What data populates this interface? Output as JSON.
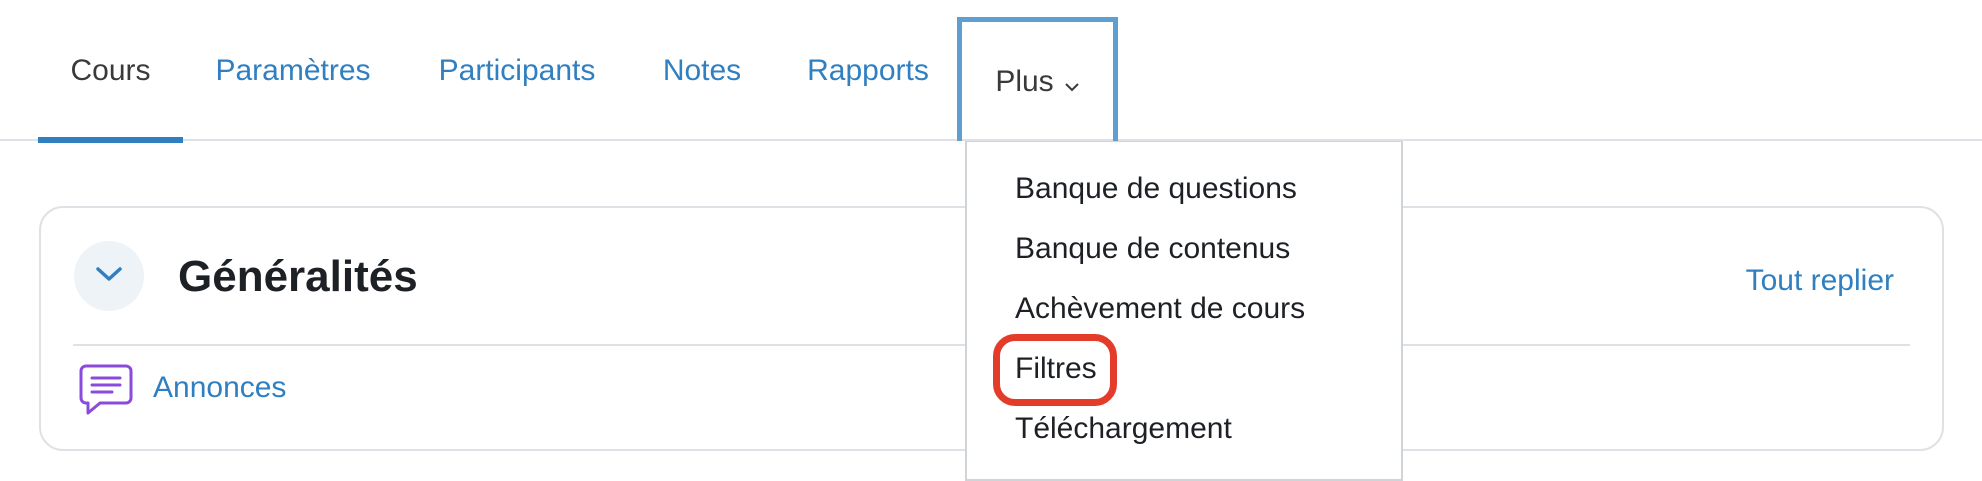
{
  "nav": {
    "tabs": [
      {
        "label": "Cours"
      },
      {
        "label": "Paramètres"
      },
      {
        "label": "Participants"
      },
      {
        "label": "Notes"
      },
      {
        "label": "Rapports"
      },
      {
        "label": "Plus"
      }
    ]
  },
  "section": {
    "title": "Généralités",
    "collapse_all_label": "Tout replier",
    "activities": [
      {
        "label": "Annonces",
        "icon": "forum-icon"
      }
    ]
  },
  "dropdown": {
    "items": [
      {
        "label": "Banque de questions"
      },
      {
        "label": "Banque de contenus"
      },
      {
        "label": "Achèvement de cours"
      },
      {
        "label": "Filtres"
      },
      {
        "label": "Téléchargement"
      }
    ]
  },
  "colors": {
    "link": "#2f7fc1",
    "text": "#1d2125",
    "highlight": "#e43c2b",
    "forum_icon": "#8a4bdc"
  }
}
